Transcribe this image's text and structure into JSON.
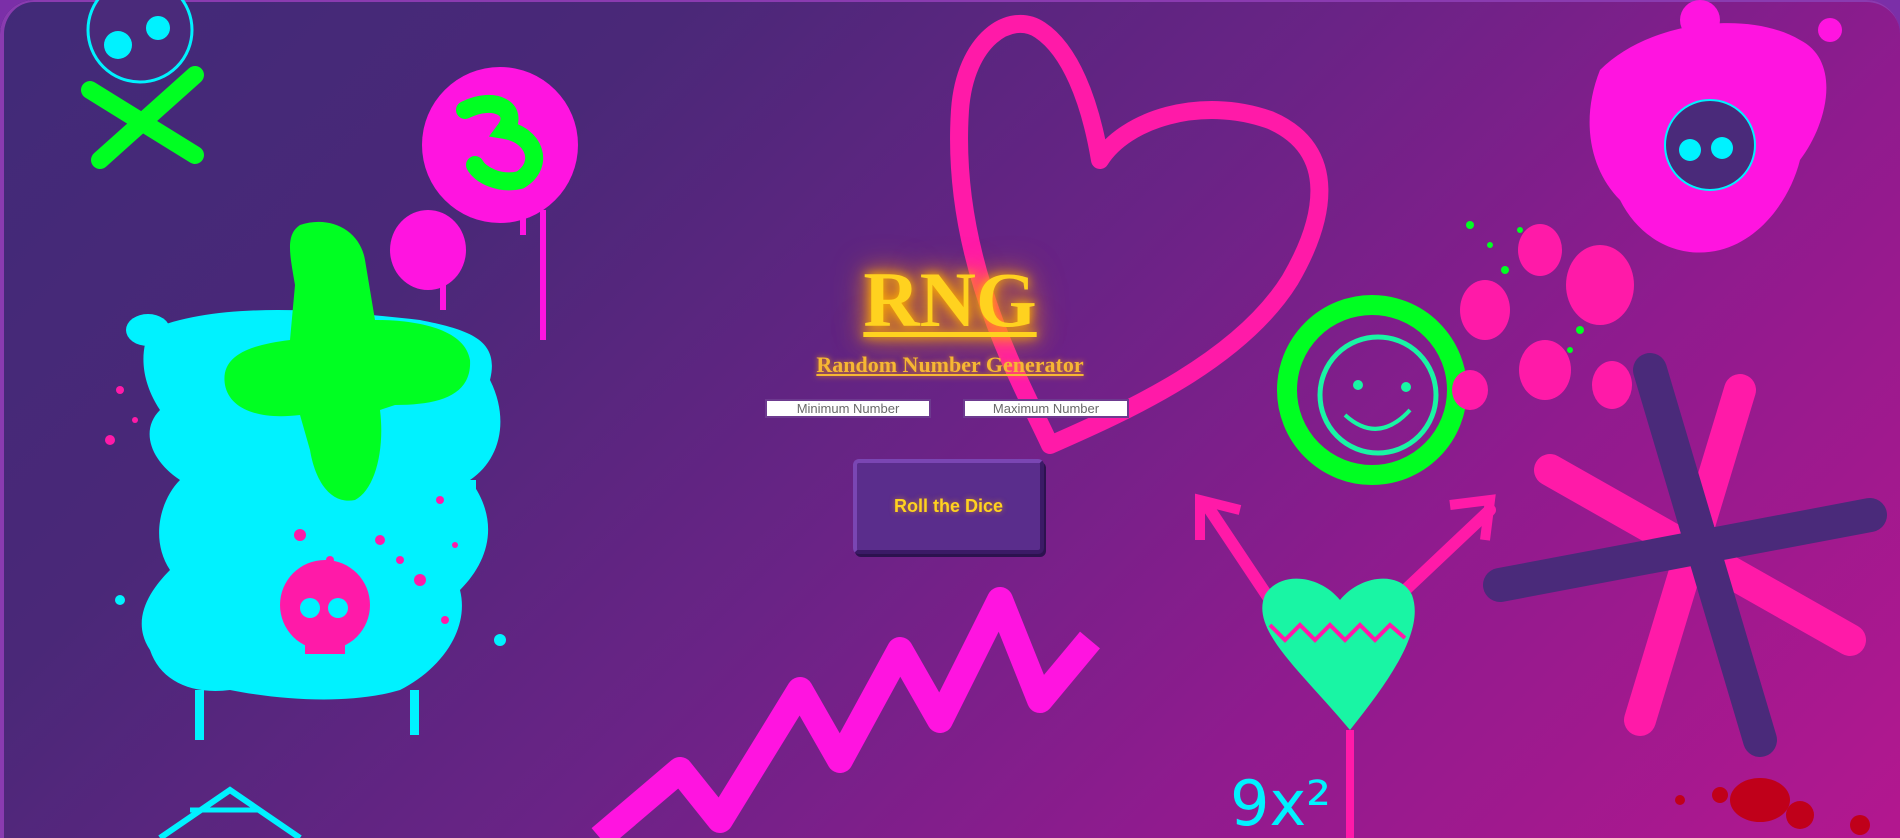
{
  "header": {
    "title": "RNG",
    "subtitle": "Random Number Generator"
  },
  "form": {
    "min_placeholder": "Minimum Number",
    "max_placeholder": "Maximum Number",
    "min_value": "",
    "max_value": "",
    "roll_label": "Roll the Dice"
  },
  "background": {
    "doodle_text": "9x²"
  },
  "colors": {
    "title": "#ffd21f",
    "subtitle": "#f7b733",
    "button_bg": "#5a2d8c",
    "neon_pink": "#ff1aa8",
    "neon_magenta": "#ff14e0",
    "neon_green": "#00ff22",
    "neon_cyan": "#00f2ff",
    "mint": "#19f5a4",
    "dark_purple": "#4a2a7a",
    "blood_red": "#c0001a"
  }
}
